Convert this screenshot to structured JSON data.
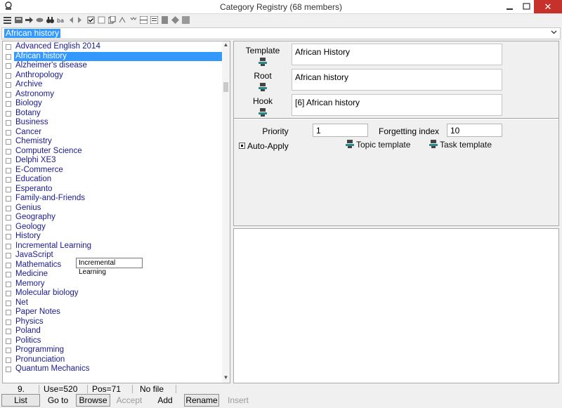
{
  "window": {
    "title": "Category Registry (68 members)",
    "close_glyph": "✕",
    "minimize_glyph": "—",
    "maximize_glyph": "□"
  },
  "combo": {
    "value": "African history"
  },
  "list": {
    "selected_index": 1,
    "items": [
      "Advanced English 2014",
      "African history",
      "Alzheimer's disease",
      "Anthropology",
      "Archive",
      "Astronomy",
      "Biology",
      "Botany",
      "Business",
      "Cancer",
      "Chemistry",
      "Computer Science",
      "Delphi XE3",
      "E-Commerce",
      "Education",
      "Esperanto",
      "Family-and-Friends",
      "Genius",
      "Geography",
      "Geology",
      "History",
      "Incremental Learning",
      "JavaScript",
      "Mathematics",
      "Medicine",
      "Memory",
      "Molecular biology",
      "Net",
      "Paper Notes",
      "Physics",
      "Poland",
      "Politics",
      "Programming",
      "Pronunciation",
      "Quantum Mechanics"
    ],
    "tooltip": "Incremental Learning"
  },
  "details": {
    "template_label": "Template",
    "template_value": "African History",
    "root_label": "Root",
    "root_value": "African history",
    "hook_label": "Hook",
    "hook_value": "[6] African history",
    "priority_label": "Priority",
    "priority_value": "1",
    "forgetting_label": "Forgetting index",
    "forgetting_value": "10",
    "auto_apply_label": "Auto-Apply",
    "topic_template_label": "Topic template",
    "task_template_label": "Task template"
  },
  "status": {
    "number": "9.",
    "use": "Use=520",
    "pos": "Pos=71",
    "file": "No file"
  },
  "buttons": {
    "list": "List",
    "goto": "Go to",
    "browse": "Browse",
    "accept": "Accept",
    "add": "Add",
    "rename": "Rename",
    "insert": "Insert"
  },
  "colors": {
    "selection": "#3399ff",
    "close_button": "#c7312c",
    "list_text": "#1a1a8c",
    "gear_teal": "#2a8a8a"
  }
}
